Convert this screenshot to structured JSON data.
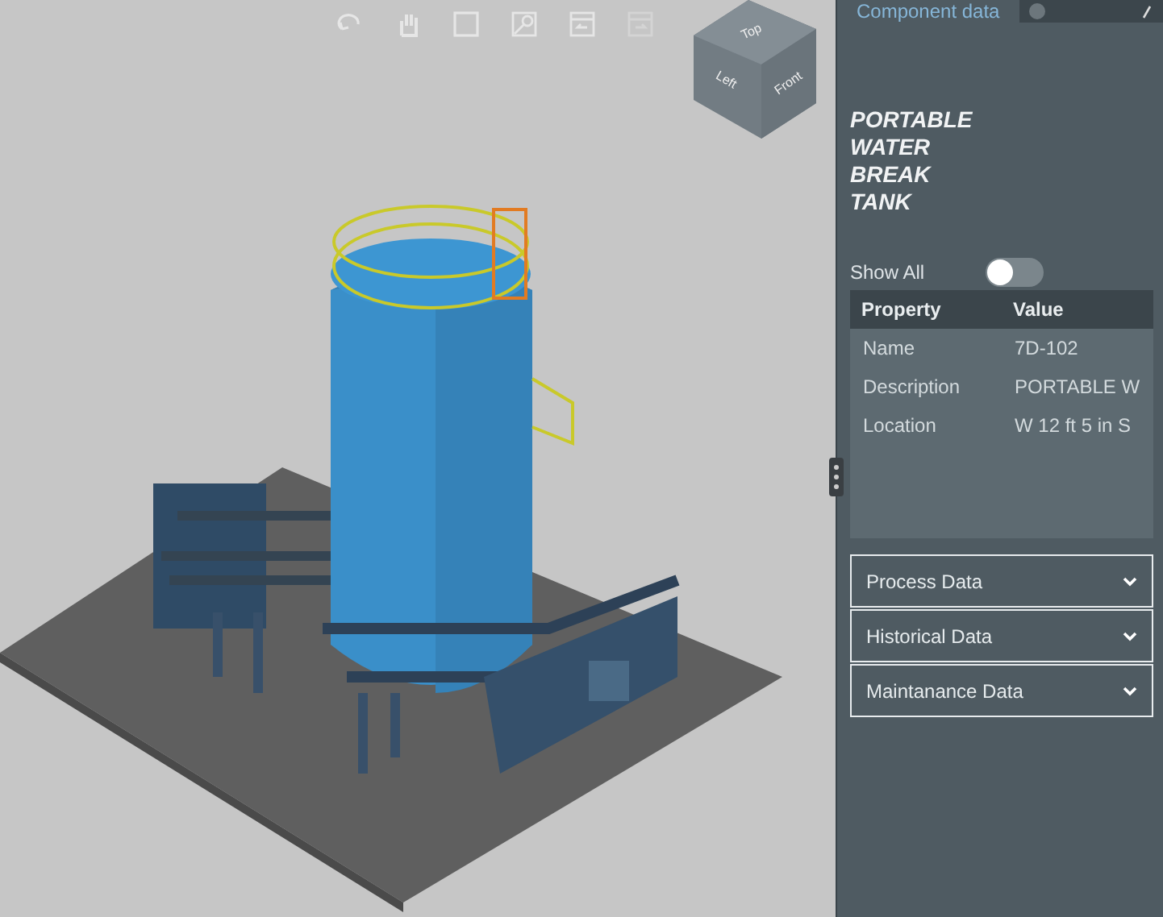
{
  "viewer": {
    "cube_faces": [
      "Top",
      "Left",
      "Front"
    ]
  },
  "panel": {
    "tab": "Component data",
    "title": "PORTABLE WATER BREAK TANK",
    "show_all": {
      "label": "Show All",
      "on": false
    },
    "table": {
      "columns": [
        "Property",
        "Value"
      ],
      "rows": [
        {
          "property": "Name",
          "value": "7D-102"
        },
        {
          "property": "Description",
          "value": "PORTABLE W"
        },
        {
          "property": "Location",
          "value": "W 12 ft 5 in S"
        }
      ]
    },
    "sections": [
      {
        "label": "Process Data",
        "expanded": false
      },
      {
        "label": "Historical Data",
        "expanded": false
      },
      {
        "label": "Maintanance Data",
        "expanded": false
      }
    ]
  }
}
